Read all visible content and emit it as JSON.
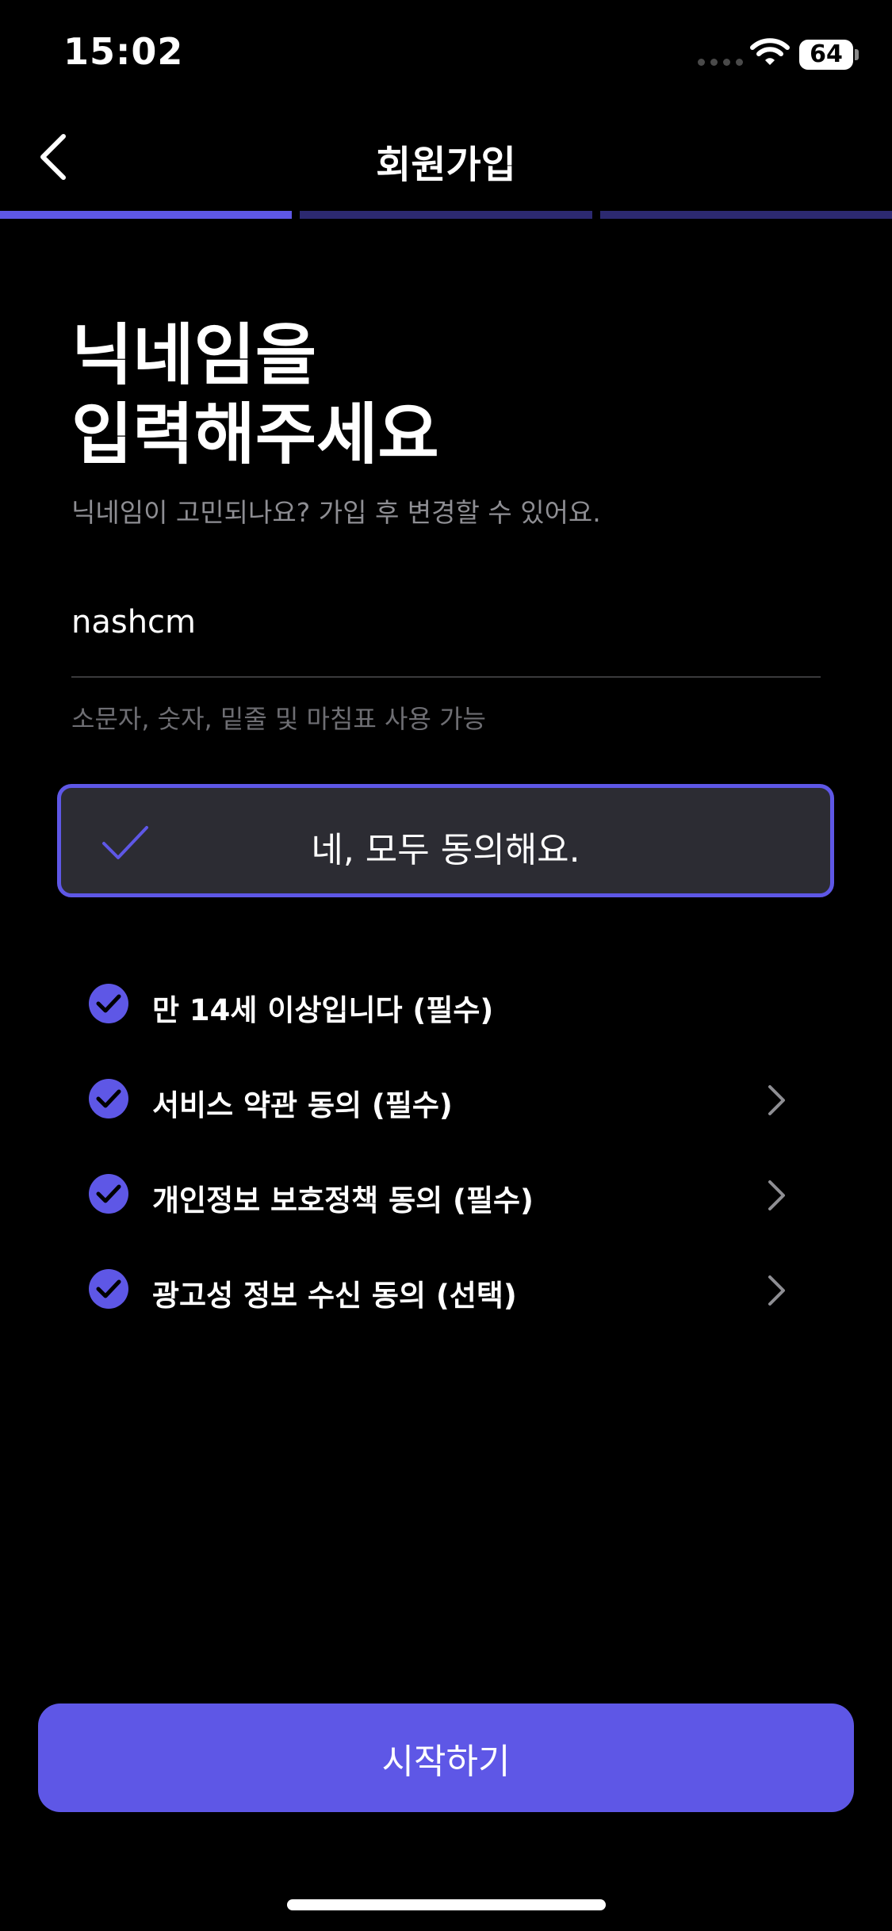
{
  "status_bar": {
    "time": "15:02",
    "battery": "64"
  },
  "header": {
    "title": "회원가입"
  },
  "progress": {
    "total_steps": 3,
    "current_step": 1
  },
  "heading": {
    "line1": "닉네임을",
    "line2": "입력해주세요"
  },
  "subtitle": "닉네임이 고민되나요? 가입 후 변경할 수 있어요.",
  "nickname_input": {
    "value": "nashcm",
    "hint": "소문자, 숫자, 밑줄 및 마침표 사용 가능"
  },
  "agree_all": {
    "label": "네, 모두 동의해요.",
    "checked": true
  },
  "terms": [
    {
      "label": "만 14세 이상입니다 (필수)",
      "checked": true,
      "has_detail": false
    },
    {
      "label": "서비스 약관 동의 (필수)",
      "checked": true,
      "has_detail": true
    },
    {
      "label": "개인정보 보호정책 동의 (필수)",
      "checked": true,
      "has_detail": true
    },
    {
      "label": "광고성 정보 수신 동의 (선택)",
      "checked": true,
      "has_detail": true
    }
  ],
  "start_button": {
    "label": "시작하기"
  },
  "colors": {
    "accent": "#5e57e6",
    "background": "#000000",
    "progress_inactive": "#2c2970",
    "card_background": "#2c2c33"
  }
}
